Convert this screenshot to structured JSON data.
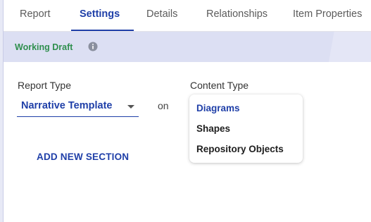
{
  "tabs": [
    {
      "label": "Report"
    },
    {
      "label": "Settings",
      "active": true
    },
    {
      "label": "Details"
    },
    {
      "label": "Relationships"
    },
    {
      "label": "Item Properties"
    }
  ],
  "status": {
    "label": "Working Draft",
    "icon": "info-icon",
    "color": "#2f8f4e"
  },
  "report_type": {
    "label": "Report Type",
    "value": "Narrative Template"
  },
  "connector_label": "on",
  "content_type": {
    "label": "Content Type",
    "options": [
      {
        "label": "Diagrams",
        "selected": true
      },
      {
        "label": "Shapes"
      },
      {
        "label": "Repository Objects"
      }
    ]
  },
  "add_section_label": "ADD NEW SECTION",
  "colors": {
    "accent": "#1f3fa8",
    "status_green": "#2f8f4e",
    "band": "#dcdff3"
  }
}
